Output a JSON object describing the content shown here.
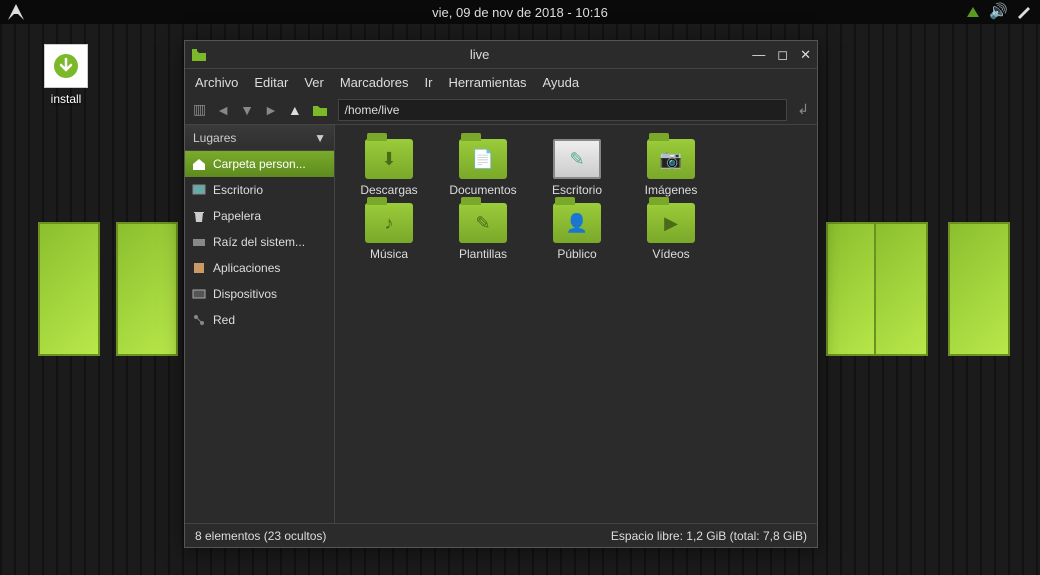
{
  "panel": {
    "clock": "vie, 09 de nov de 2018 - 10:16"
  },
  "desktop": {
    "install_label": "install"
  },
  "window": {
    "title": "live",
    "path": "/home/live",
    "menu": {
      "archivo": "Archivo",
      "editar": "Editar",
      "ver": "Ver",
      "marcadores": "Marcadores",
      "ir": "Ir",
      "herramientas": "Herramientas",
      "ayuda": "Ayuda"
    },
    "sidebar": {
      "header": "Lugares",
      "items": [
        {
          "label": "Carpeta person...",
          "selected": true
        },
        {
          "label": "Escritorio"
        },
        {
          "label": "Papelera"
        },
        {
          "label": "Raíz del sistem..."
        },
        {
          "label": "Aplicaciones"
        },
        {
          "label": "Dispositivos"
        },
        {
          "label": "Red"
        }
      ]
    },
    "folders": [
      {
        "label": "Descargas",
        "glyph": "⬇"
      },
      {
        "label": "Documentos",
        "glyph": "📄"
      },
      {
        "label": "Escritorio",
        "type": "desktop",
        "glyph": "🖥"
      },
      {
        "label": "Imágenes",
        "glyph": "📷"
      },
      {
        "label": "Música",
        "glyph": "♪"
      },
      {
        "label": "Plantillas",
        "glyph": "✎"
      },
      {
        "label": "Público",
        "glyph": "👤"
      },
      {
        "label": "Vídeos",
        "glyph": "▶"
      }
    ],
    "status": {
      "left": "8 elementos (23 ocultos)",
      "right": "Espacio libre: 1,2 GiB (total: 7,8 GiB)"
    }
  }
}
